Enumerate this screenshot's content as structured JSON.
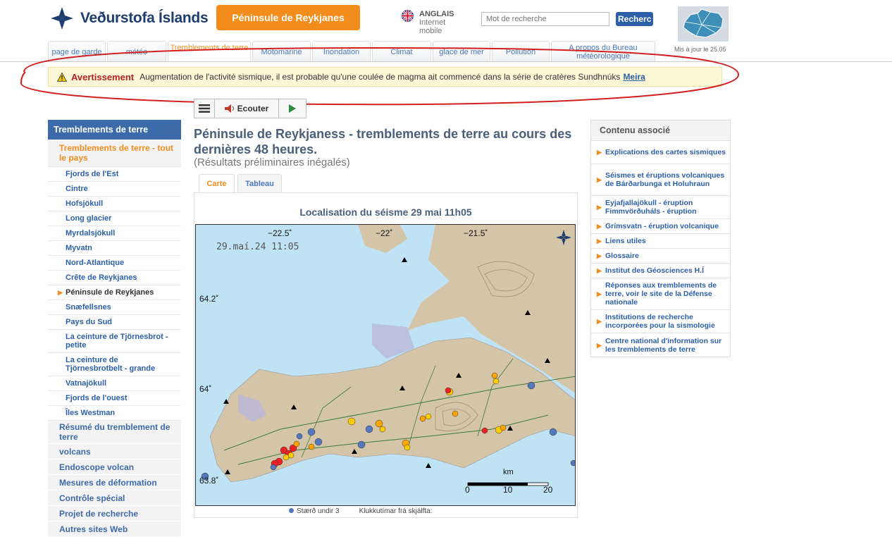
{
  "header": {
    "logo_text": "Veðurstofa Íslands",
    "region_button": "Péninsule de Reykjanes",
    "language": {
      "label": "ANGLAIS",
      "line2": "Internet",
      "line3": "mobile"
    },
    "search": {
      "placeholder": "Mot de recherche",
      "button": "Recherc"
    },
    "updated": "Mis à jour le 25.05"
  },
  "nav": {
    "tabs": [
      {
        "label": "page de garde"
      },
      {
        "label": "météo"
      },
      {
        "label": "Tremblements de terre",
        "active": true
      },
      {
        "label": "Motomarine"
      },
      {
        "label": "Inondation"
      },
      {
        "label": "Climat"
      },
      {
        "label": "glace de mer"
      },
      {
        "label": "Pollution"
      },
      {
        "label": "A propos du Bureau météorologique"
      }
    ]
  },
  "warning": {
    "title": "Avertissement",
    "text": "Augmentation de l'activité sismique, il est probable qu'une coulée de magma ait commencé dans la série de cratères Sundhnúks",
    "more": "Meira"
  },
  "audio": {
    "listen": "Ecouter"
  },
  "sidebar": {
    "heading": "Tremblements de terre",
    "selected": "Tremblements de terre - tout le pays",
    "sub_items": [
      "Fjords de l'Est",
      "Cintre",
      "Hofsjökull",
      "Long glacier",
      "Myrdalsjökull",
      "Myvatn",
      "Nord-Atlantique",
      "Crête de Reykjanes",
      "Péninsule de Reykjanes",
      "Snæfellsnes",
      "Pays du Sud",
      "La ceinture de Tjörnesbrot - petite",
      "La ceinture de Tjörnesbrotbelt - grande",
      "Vatnajökull",
      "Fjords de l'ouest",
      "Îles Westman"
    ],
    "current_sub": "Péninsule de Reykjanes",
    "main_items": [
      "Résumé du tremblement de terre",
      "volcans",
      "Endoscope volcan",
      "Mesures de déformation",
      "Contrôle spécial",
      "Projet de recherche",
      "Autres sites Web"
    ]
  },
  "main": {
    "title": "Péninsule de Reykjaness - tremblements de terre au cours des dernières 48 heures.",
    "subtitle": "(Résultats préliminaires inégalés)",
    "tabs": [
      "Carte",
      "Tableau"
    ],
    "map_title": "Localisation du séisme 29 mai 11h05",
    "map": {
      "timestamp": "29.maí.24  11:05",
      "lon_labels": [
        "−22.5˚",
        "−22˚",
        "−21.5˚"
      ],
      "lat_labels": [
        "64.2˚",
        "64˚",
        "63.8˚"
      ],
      "scale_unit": "km",
      "scale_ticks": [
        "0",
        "10",
        "20"
      ]
    },
    "legend": [
      "Stærð undir 3",
      "Klukkutímar frá skjálfta:"
    ]
  },
  "related": {
    "heading": "Contenu associé",
    "items": [
      "Explications des cartes sismiques",
      "Séismes et éruptions volcaniques de Bárðarbunga et Holuhraun",
      "Eyjafjallajökull - éruption Fimmvörðuháls - éruption",
      "Grímsvatn - éruption volcanique",
      "Liens utiles",
      "Glossaire",
      "Institut des Géosciences H.Í",
      "Réponses aux tremblements de terre, voir le site de la Défense nationale",
      "Institutions de recherche incorporées pour la sismologie",
      "Centre national d'information sur les tremblements de terre"
    ]
  },
  "colors": {
    "accent": "#f28c1c",
    "link": "#2b5fa8",
    "nav_head": "#3d6aa8",
    "warning_bg": "#fcf7d6",
    "annotation": "#d21f1f"
  }
}
